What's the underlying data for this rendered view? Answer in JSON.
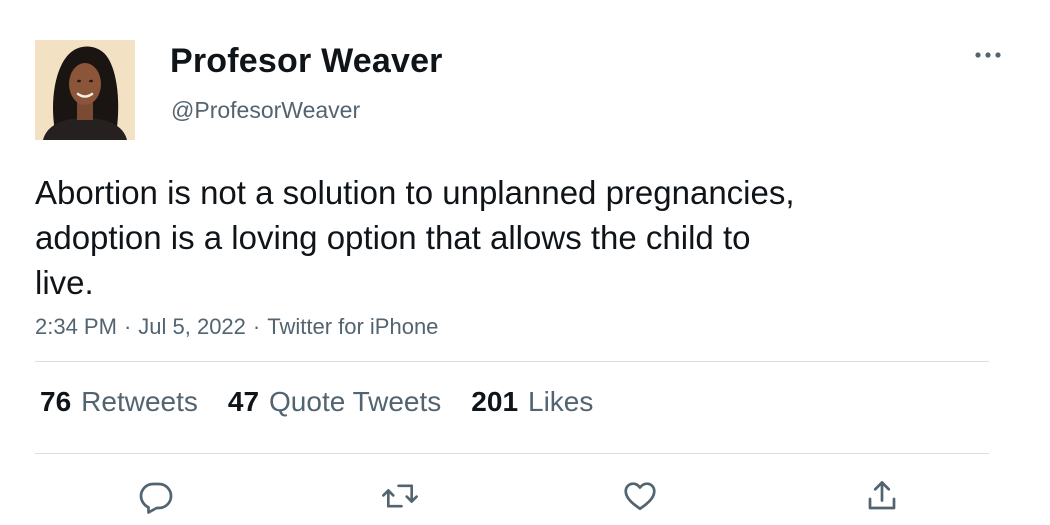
{
  "user": {
    "display_name": "Profesor Weaver",
    "handle": "@ProfesorWeaver",
    "avatar_icon": "profile-photo"
  },
  "tweet": {
    "text_lines": [
      "Abortion is not a solution to unplanned pregnancies,",
      "adoption is a loving option that allows the child to",
      "live."
    ],
    "time": "2:34 PM",
    "date": "Jul 5, 2022",
    "separator": "·",
    "source": "Twitter for iPhone"
  },
  "stats": {
    "retweets_count": "76",
    "retweets_label": "Retweets",
    "quotes_count": "47",
    "quotes_label": "Quote Tweets",
    "likes_count": "201",
    "likes_label": "Likes"
  },
  "actions": {
    "icons": [
      "more-icon",
      "reply-icon",
      "retweet-icon",
      "like-icon",
      "share-icon"
    ]
  },
  "colors": {
    "text": "#0f1419",
    "secondary": "#536471",
    "divider": "#d9dee2",
    "background": "#ffffff"
  }
}
